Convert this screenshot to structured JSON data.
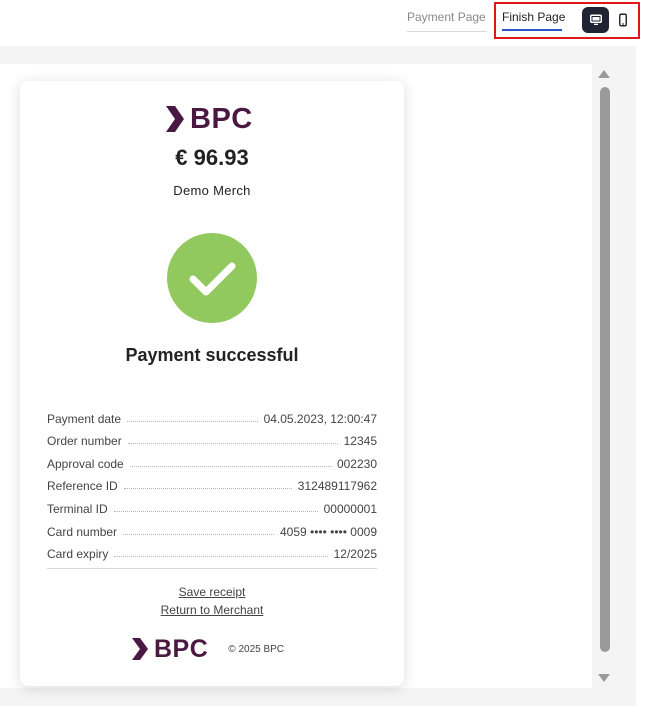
{
  "tabs": {
    "payment_page": "Payment Page",
    "finish_page": "Finish Page"
  },
  "devices": {
    "desktop_icon": "monitor-icon",
    "mobile_icon": "smartphone-icon",
    "selected": "desktop"
  },
  "receipt": {
    "logo_text": "BPC",
    "amount": "€ 96.93",
    "merchant": "Demo Merch",
    "status_title": "Payment successful",
    "details": [
      {
        "label": "Payment date",
        "value": "04.05.2023, 12:00:47"
      },
      {
        "label": "Order number",
        "value": "12345"
      },
      {
        "label": "Approval code",
        "value": "002230"
      },
      {
        "label": "Reference ID",
        "value": "312489117962"
      },
      {
        "label": "Terminal ID",
        "value": "00000001"
      },
      {
        "label": "Card number",
        "value": "4059 •••• •••• 0009"
      },
      {
        "label": "Card expiry",
        "value": "12/2025"
      }
    ],
    "save_receipt": "Save receipt",
    "return_to_merchant": "Return to Merchant",
    "footer_logo_text": "BPC",
    "copyright": "© 2025 BPC"
  },
  "colors": {
    "brand": "#4a1942",
    "success": "#92c95f",
    "tab_active_underline": "#2b56c9",
    "highlight": "#e0161b",
    "device_active_bg": "#1f2433"
  }
}
